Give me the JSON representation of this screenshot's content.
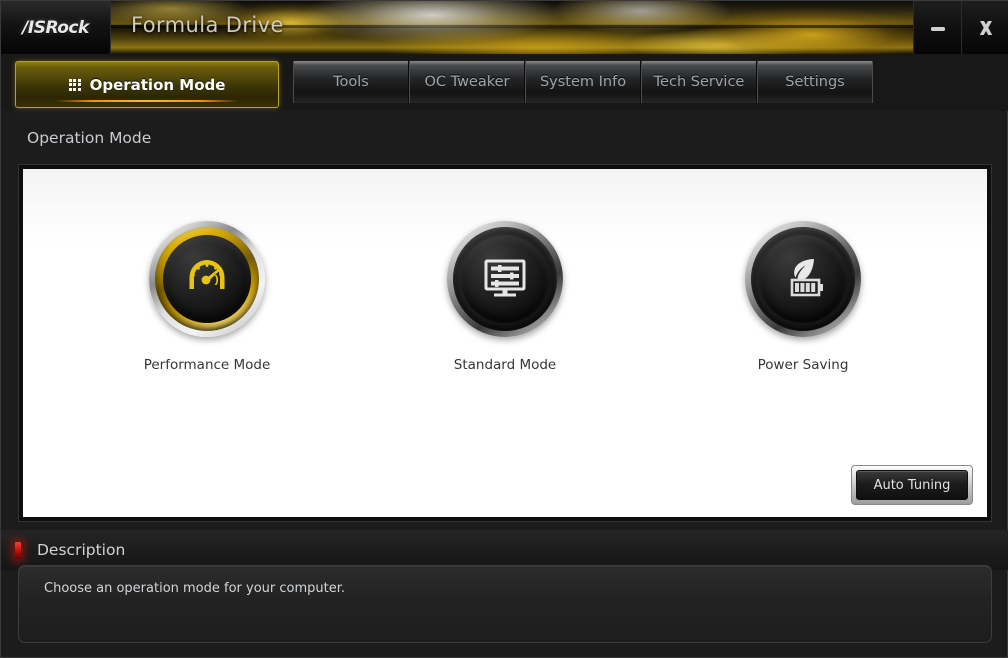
{
  "window": {
    "brand": "/ISRock",
    "title": "Formula Drive",
    "minimize_label": "minimize-icon",
    "close_label": "close-icon"
  },
  "tabs": [
    {
      "label": "Operation Mode",
      "active": true,
      "icon": "grid-icon"
    },
    {
      "label": "Tools",
      "active": false
    },
    {
      "label": "OC Tweaker",
      "active": false
    },
    {
      "label": "System Info",
      "active": false
    },
    {
      "label": "Tech Service",
      "active": false
    },
    {
      "label": "Settings",
      "active": false
    }
  ],
  "page": {
    "heading": "Operation Mode"
  },
  "modes": [
    {
      "label": "Performance Mode",
      "icon": "speedometer-icon",
      "selected": true,
      "accent": "#e8b400"
    },
    {
      "label": "Standard Mode",
      "icon": "monitor-icon",
      "selected": false,
      "accent": "#d9d9d9"
    },
    {
      "label": "Power Saving",
      "icon": "leaf-battery-icon",
      "selected": false,
      "accent": "#d9d9d9"
    }
  ],
  "actions": {
    "auto_tuning_label": "Auto Tuning"
  },
  "description": {
    "title": "Description",
    "text": "Choose an operation mode for your computer."
  },
  "colors": {
    "accent_gold": "#e8b400",
    "marker_red": "#c81409",
    "panel_bg": "#ffffff",
    "chrome_dark": "#1c1c1c"
  }
}
